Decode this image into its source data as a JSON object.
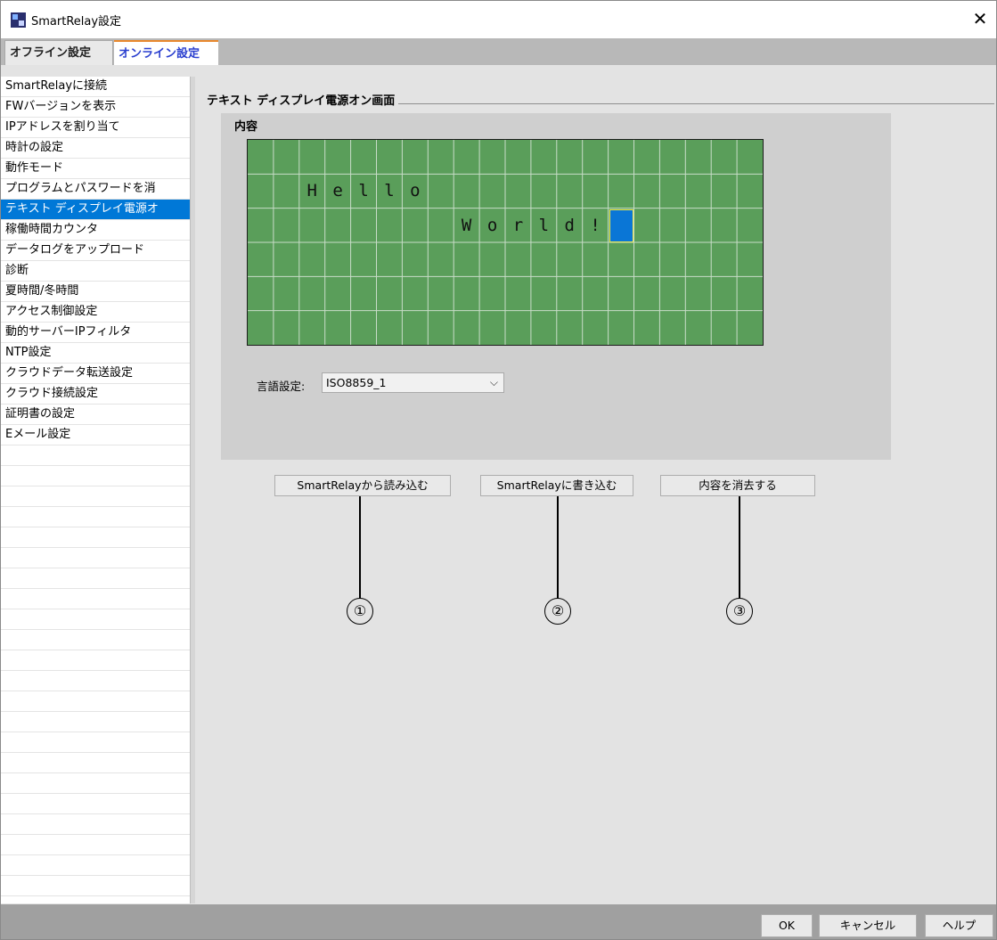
{
  "window": {
    "title": "SmartRelay設定",
    "close_label": "✕"
  },
  "tabs": [
    {
      "label": "オフライン設定"
    },
    {
      "label": "オンライン設定"
    }
  ],
  "sidebar": {
    "items": [
      {
        "label": "SmartRelayに接続"
      },
      {
        "label": "FWバージョンを表示"
      },
      {
        "label": "IPアドレスを割り当て"
      },
      {
        "label": "時計の設定"
      },
      {
        "label": "動作モード"
      },
      {
        "label": "プログラムとパスワードを消"
      },
      {
        "label": "テキスト ディスプレイ電源オ"
      },
      {
        "label": "稼働時間カウンタ"
      },
      {
        "label": "データログをアップロード"
      },
      {
        "label": "診断"
      },
      {
        "label": "夏時間/冬時間"
      },
      {
        "label": "アクセス制御設定"
      },
      {
        "label": "動的サーバーIPフィルタ"
      },
      {
        "label": "NTP設定"
      },
      {
        "label": "クラウドデータ転送設定"
      },
      {
        "label": "クラウド接続設定"
      },
      {
        "label": "証明書の設定"
      },
      {
        "label": "Eメール設定"
      }
    ],
    "selected_index": 6
  },
  "main": {
    "group_title": "テキスト ディスプレイ電源オン画面",
    "content_label": "内容",
    "display": {
      "columns": 20,
      "rows": 6,
      "lines": [
        {
          "row": 1,
          "col": 2,
          "text": "Hello"
        },
        {
          "row": 2,
          "col": 8,
          "text": "World!"
        }
      ],
      "cursor": {
        "row": 2,
        "col": 14
      },
      "colors": {
        "background": "#5a9e5a",
        "grid": "#c8dcc8",
        "cursor": "#0a76d6",
        "cursor_border": "#f2e84a"
      }
    },
    "language": {
      "label": "言語設定:",
      "value": "ISO8859_1"
    },
    "buttons": {
      "read": "SmartRelayから読み込む",
      "write": "SmartRelayに書き込む",
      "clear": "内容を消去する"
    },
    "callouts": [
      "①",
      "②",
      "③"
    ]
  },
  "footer": {
    "ok": "OK",
    "cancel": "キャンセル",
    "help": "ヘルプ"
  }
}
